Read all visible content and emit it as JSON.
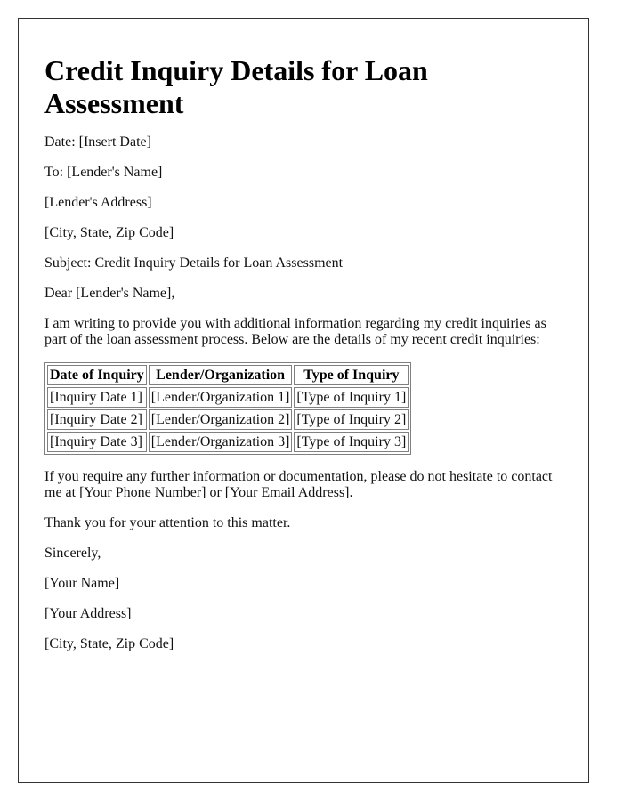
{
  "document": {
    "title": "Credit Inquiry Details for Loan Assessment",
    "header_lines": {
      "date": "Date: [Insert Date]",
      "to": "To: [Lender's Name]",
      "lender_address": "[Lender's Address]",
      "lender_city": "[City, State, Zip Code]",
      "subject": "Subject: Credit Inquiry Details for Loan Assessment"
    },
    "salutation": "Dear [Lender's Name],",
    "intro_paragraph": "I am writing to provide you with additional information regarding my credit inquiries as part of the loan assessment process. Below are the details of my recent credit inquiries:",
    "table": {
      "headers": [
        "Date of Inquiry",
        "Lender/Organization",
        "Type of Inquiry"
      ],
      "rows": [
        [
          "[Inquiry Date 1]",
          "[Lender/Organization 1]",
          "[Type of Inquiry 1]"
        ],
        [
          "[Inquiry Date 2]",
          "[Lender/Organization 2]",
          "[Type of Inquiry 2]"
        ],
        [
          "[Inquiry Date 3]",
          "[Lender/Organization 3]",
          "[Type of Inquiry 3]"
        ]
      ]
    },
    "contact_paragraph": "If you require any further information or documentation, please do not hesitate to contact me at [Your Phone Number] or [Your Email Address].",
    "thanks": "Thank you for your attention to this matter.",
    "closing": "Sincerely,",
    "signature": {
      "name": "[Your Name]",
      "address": "[Your Address]",
      "city": "[City, State, Zip Code]"
    }
  }
}
